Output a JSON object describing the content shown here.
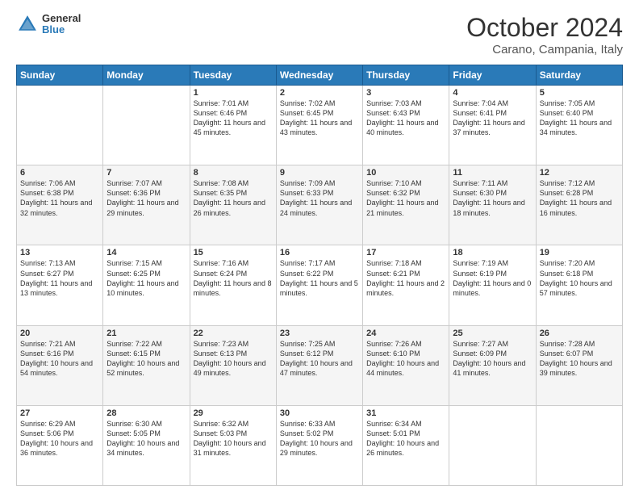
{
  "header": {
    "logo": {
      "general": "General",
      "blue": "Blue"
    },
    "title": "October 2024",
    "location": "Carano, Campania, Italy"
  },
  "calendar": {
    "days": [
      "Sunday",
      "Monday",
      "Tuesday",
      "Wednesday",
      "Thursday",
      "Friday",
      "Saturday"
    ],
    "weeks": [
      [
        {
          "day": "",
          "info": ""
        },
        {
          "day": "",
          "info": ""
        },
        {
          "day": "1",
          "info": "Sunrise: 7:01 AM\nSunset: 6:46 PM\nDaylight: 11 hours and 45 minutes."
        },
        {
          "day": "2",
          "info": "Sunrise: 7:02 AM\nSunset: 6:45 PM\nDaylight: 11 hours and 43 minutes."
        },
        {
          "day": "3",
          "info": "Sunrise: 7:03 AM\nSunset: 6:43 PM\nDaylight: 11 hours and 40 minutes."
        },
        {
          "day": "4",
          "info": "Sunrise: 7:04 AM\nSunset: 6:41 PM\nDaylight: 11 hours and 37 minutes."
        },
        {
          "day": "5",
          "info": "Sunrise: 7:05 AM\nSunset: 6:40 PM\nDaylight: 11 hours and 34 minutes."
        }
      ],
      [
        {
          "day": "6",
          "info": "Sunrise: 7:06 AM\nSunset: 6:38 PM\nDaylight: 11 hours and 32 minutes."
        },
        {
          "day": "7",
          "info": "Sunrise: 7:07 AM\nSunset: 6:36 PM\nDaylight: 11 hours and 29 minutes."
        },
        {
          "day": "8",
          "info": "Sunrise: 7:08 AM\nSunset: 6:35 PM\nDaylight: 11 hours and 26 minutes."
        },
        {
          "day": "9",
          "info": "Sunrise: 7:09 AM\nSunset: 6:33 PM\nDaylight: 11 hours and 24 minutes."
        },
        {
          "day": "10",
          "info": "Sunrise: 7:10 AM\nSunset: 6:32 PM\nDaylight: 11 hours and 21 minutes."
        },
        {
          "day": "11",
          "info": "Sunrise: 7:11 AM\nSunset: 6:30 PM\nDaylight: 11 hours and 18 minutes."
        },
        {
          "day": "12",
          "info": "Sunrise: 7:12 AM\nSunset: 6:28 PM\nDaylight: 11 hours and 16 minutes."
        }
      ],
      [
        {
          "day": "13",
          "info": "Sunrise: 7:13 AM\nSunset: 6:27 PM\nDaylight: 11 hours and 13 minutes."
        },
        {
          "day": "14",
          "info": "Sunrise: 7:15 AM\nSunset: 6:25 PM\nDaylight: 11 hours and 10 minutes."
        },
        {
          "day": "15",
          "info": "Sunrise: 7:16 AM\nSunset: 6:24 PM\nDaylight: 11 hours and 8 minutes."
        },
        {
          "day": "16",
          "info": "Sunrise: 7:17 AM\nSunset: 6:22 PM\nDaylight: 11 hours and 5 minutes."
        },
        {
          "day": "17",
          "info": "Sunrise: 7:18 AM\nSunset: 6:21 PM\nDaylight: 11 hours and 2 minutes."
        },
        {
          "day": "18",
          "info": "Sunrise: 7:19 AM\nSunset: 6:19 PM\nDaylight: 11 hours and 0 minutes."
        },
        {
          "day": "19",
          "info": "Sunrise: 7:20 AM\nSunset: 6:18 PM\nDaylight: 10 hours and 57 minutes."
        }
      ],
      [
        {
          "day": "20",
          "info": "Sunrise: 7:21 AM\nSunset: 6:16 PM\nDaylight: 10 hours and 54 minutes."
        },
        {
          "day": "21",
          "info": "Sunrise: 7:22 AM\nSunset: 6:15 PM\nDaylight: 10 hours and 52 minutes."
        },
        {
          "day": "22",
          "info": "Sunrise: 7:23 AM\nSunset: 6:13 PM\nDaylight: 10 hours and 49 minutes."
        },
        {
          "day": "23",
          "info": "Sunrise: 7:25 AM\nSunset: 6:12 PM\nDaylight: 10 hours and 47 minutes."
        },
        {
          "day": "24",
          "info": "Sunrise: 7:26 AM\nSunset: 6:10 PM\nDaylight: 10 hours and 44 minutes."
        },
        {
          "day": "25",
          "info": "Sunrise: 7:27 AM\nSunset: 6:09 PM\nDaylight: 10 hours and 41 minutes."
        },
        {
          "day": "26",
          "info": "Sunrise: 7:28 AM\nSunset: 6:07 PM\nDaylight: 10 hours and 39 minutes."
        }
      ],
      [
        {
          "day": "27",
          "info": "Sunrise: 6:29 AM\nSunset: 5:06 PM\nDaylight: 10 hours and 36 minutes."
        },
        {
          "day": "28",
          "info": "Sunrise: 6:30 AM\nSunset: 5:05 PM\nDaylight: 10 hours and 34 minutes."
        },
        {
          "day": "29",
          "info": "Sunrise: 6:32 AM\nSunset: 5:03 PM\nDaylight: 10 hours and 31 minutes."
        },
        {
          "day": "30",
          "info": "Sunrise: 6:33 AM\nSunset: 5:02 PM\nDaylight: 10 hours and 29 minutes."
        },
        {
          "day": "31",
          "info": "Sunrise: 6:34 AM\nSunset: 5:01 PM\nDaylight: 10 hours and 26 minutes."
        },
        {
          "day": "",
          "info": ""
        },
        {
          "day": "",
          "info": ""
        }
      ]
    ]
  }
}
